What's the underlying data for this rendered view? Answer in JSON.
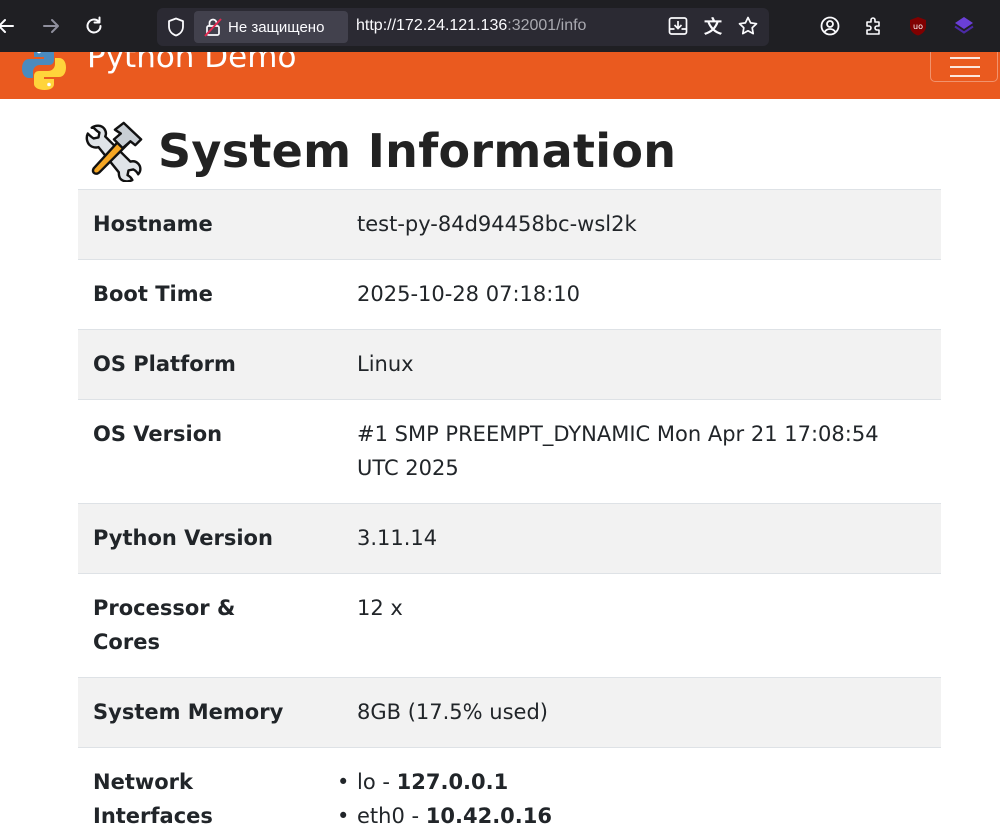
{
  "browser": {
    "security_label": "Не защищено",
    "url_host": "http://172.24.121.136",
    "url_rest": ":32001/info",
    "icons": [
      "back-icon",
      "forward-icon",
      "reload-icon",
      "shield-icon",
      "insecure-lock-icon",
      "download-icon",
      "translate-icon",
      "bookmark-star-icon",
      "account-icon",
      "extensions-icon",
      "ublock-icon",
      "extension-icon"
    ]
  },
  "navbar": {
    "brand": "Python Demo",
    "brand_color": "#ea5a1f"
  },
  "page": {
    "title": "System Information"
  },
  "info": {
    "rows": [
      {
        "label": "Hostname",
        "value": "test-py-84d94458bc-wsl2k"
      },
      {
        "label": "Boot Time",
        "value": "2025-10-28 07:18:10"
      },
      {
        "label": "OS Platform",
        "value": "Linux"
      },
      {
        "label": "OS Version",
        "value": "#1 SMP PREEMPT_DYNAMIC Mon Apr 21 17:08:54 UTC 2025"
      },
      {
        "label": "Python Version",
        "value": "3.11.14"
      },
      {
        "label": "Processor & Cores",
        "value": "12 x"
      },
      {
        "label": "System Memory",
        "value": "8GB (17.5% used)"
      },
      {
        "label": "Network Interfaces",
        "interfaces": [
          {
            "name": "lo",
            "sep": " - ",
            "ip": "127.0.0.1"
          },
          {
            "name": "eth0",
            "sep": " - ",
            "ip": "10.42.0.16"
          }
        ]
      }
    ]
  }
}
